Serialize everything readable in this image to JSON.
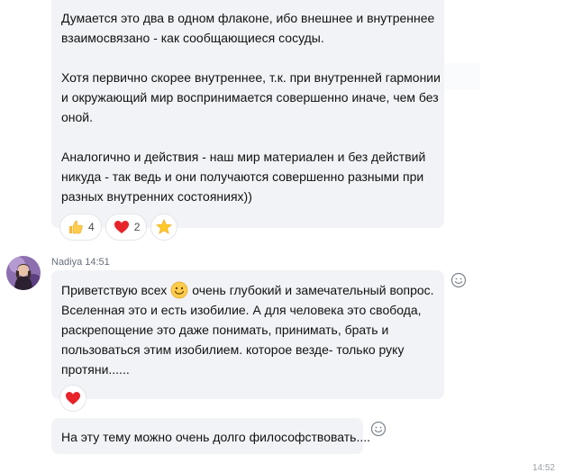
{
  "message_1": {
    "lines": [
      "Думается это два в одном флаконе, ибо внешнее и внутреннее",
      "взаимосвязано - как сообщающиеся сосуды.",
      "",
      "Хотя первично скорее внутреннее, т.к. при внутренней гармонии",
      "и окружающий мир воспринимается совершенно иначе, чем без",
      "оной.",
      "",
      "Аналогично и действия - наш мир материален и без действий",
      "никуда - так ведь и они получаются совершенно разными при",
      "разных внутренних состояниях))"
    ],
    "reactions": [
      {
        "icon": "thumbs-up-icon",
        "count": "4"
      },
      {
        "icon": "heart-icon",
        "count": "2"
      },
      {
        "icon": "star-icon",
        "count": ""
      }
    ]
  },
  "message_2": {
    "sender": "Nadiya",
    "time": "14:51",
    "line1_before": "Приветствую всех",
    "line1_after": "очень глубокий и замечательный вопрос.",
    "lines": [
      "Вселенная это и есть изобилие.  А для человека это свобода,",
      "раскрепощение это даже понимать, принимать,  брать и",
      "пользоваться этим изобилием. которое везде- только руку",
      "протяни......"
    ],
    "reactions": [
      {
        "icon": "heart-icon",
        "count": ""
      }
    ]
  },
  "message_3": {
    "text": "На эту тему можно очень долго философствовать...."
  },
  "colors": {
    "bubble": "#f1f3f6",
    "heart": "#e8242b",
    "star": "#ffc928",
    "meta_text": "#666f7a"
  },
  "bottom_time": "14:52"
}
